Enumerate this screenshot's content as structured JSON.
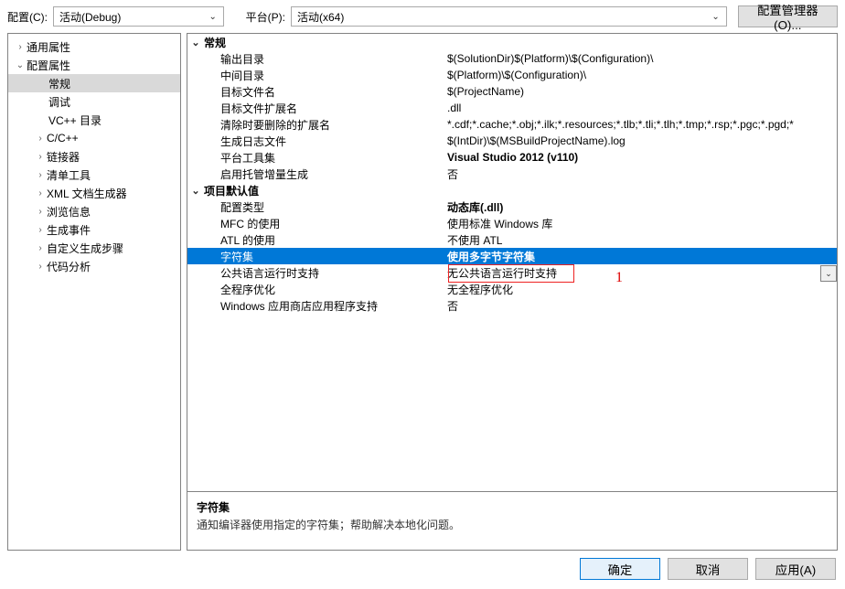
{
  "top": {
    "config_label": "配置(C):",
    "config_value": "活动(Debug)",
    "platform_label": "平台(P):",
    "platform_value": "活动(x64)",
    "manager_button": "配置管理器(O)..."
  },
  "tree": {
    "items": [
      {
        "label": "通用属性",
        "level": 1,
        "chevron": "right"
      },
      {
        "label": "配置属性",
        "level": 1,
        "chevron": "down"
      },
      {
        "label": "常规",
        "level": 2,
        "selected": true
      },
      {
        "label": "调试",
        "level": 2
      },
      {
        "label": "VC++ 目录",
        "level": 2
      },
      {
        "label": "C/C++",
        "level": 2,
        "chevron": "right"
      },
      {
        "label": "链接器",
        "level": 2,
        "chevron": "right"
      },
      {
        "label": "清单工具",
        "level": 2,
        "chevron": "right"
      },
      {
        "label": "XML 文档生成器",
        "level": 2,
        "chevron": "right"
      },
      {
        "label": "浏览信息",
        "level": 2,
        "chevron": "right"
      },
      {
        "label": "生成事件",
        "level": 2,
        "chevron": "right"
      },
      {
        "label": "自定义生成步骤",
        "level": 2,
        "chevron": "right"
      },
      {
        "label": "代码分析",
        "level": 2,
        "chevron": "right"
      }
    ]
  },
  "grid": {
    "groups": [
      {
        "header": "常规",
        "rows": [
          {
            "label": "输出目录",
            "value": "$(SolutionDir)$(Platform)\\$(Configuration)\\"
          },
          {
            "label": "中间目录",
            "value": "$(Platform)\\$(Configuration)\\"
          },
          {
            "label": "目标文件名",
            "value": "$(ProjectName)"
          },
          {
            "label": "目标文件扩展名",
            "value": ".dll"
          },
          {
            "label": "清除时要删除的扩展名",
            "value": "*.cdf;*.cache;*.obj;*.ilk;*.resources;*.tlb;*.tli;*.tlh;*.tmp;*.rsp;*.pgc;*.pgd;*"
          },
          {
            "label": "生成日志文件",
            "value": "$(IntDir)\\$(MSBuildProjectName).log"
          },
          {
            "label": "平台工具集",
            "value": "Visual Studio 2012 (v110)",
            "bold": true
          },
          {
            "label": "启用托管增量生成",
            "value": "否"
          }
        ]
      },
      {
        "header": "项目默认值",
        "rows": [
          {
            "label": "配置类型",
            "value": "动态库(.dll)",
            "bold": true
          },
          {
            "label": "MFC 的使用",
            "value": "使用标准 Windows 库"
          },
          {
            "label": "ATL 的使用",
            "value": "不使用 ATL"
          },
          {
            "label": "字符集",
            "value": "使用多字节字符集",
            "bold": true,
            "selected": true
          },
          {
            "label": "公共语言运行时支持",
            "value": "无公共语言运行时支持"
          },
          {
            "label": "全程序优化",
            "value": "无全程序优化"
          },
          {
            "label": "Windows 应用商店应用程序支持",
            "value": "否"
          }
        ]
      }
    ]
  },
  "description": {
    "title": "字符集",
    "text": "通知编译器使用指定的字符集；帮助解决本地化问题。"
  },
  "buttons": {
    "ok": "确定",
    "cancel": "取消",
    "apply": "应用(A)"
  },
  "annotation": "1"
}
